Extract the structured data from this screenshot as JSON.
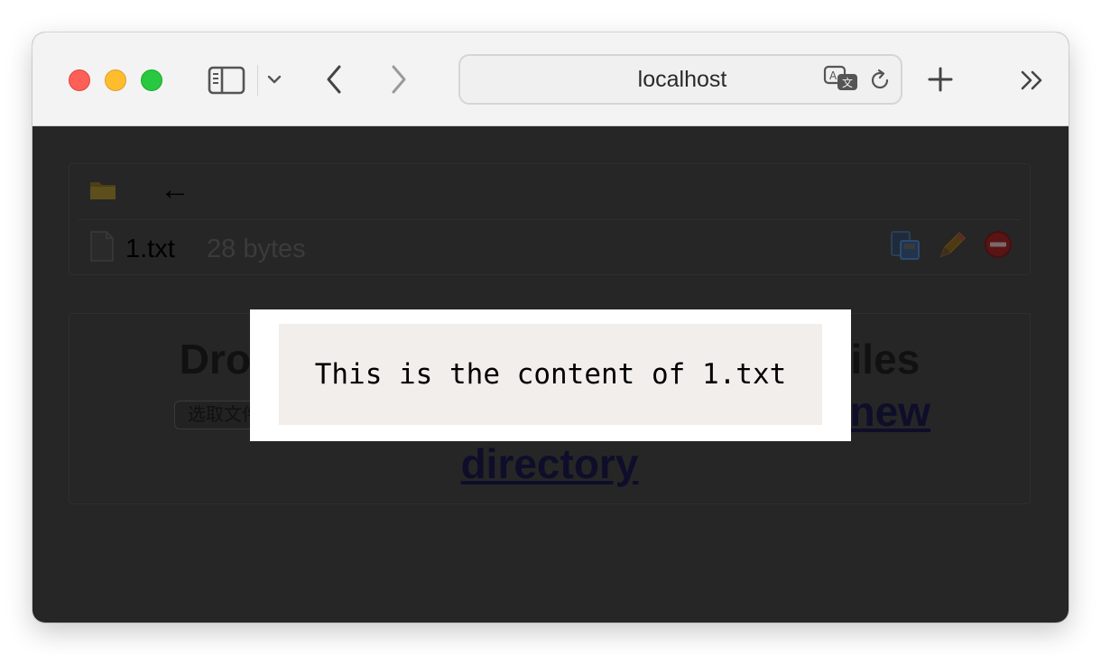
{
  "browser": {
    "address": "localhost",
    "icons": [
      "sidebar-icon",
      "chevron-down-icon",
      "back-icon",
      "forward-icon",
      "translate-icon",
      "reload-icon",
      "plus-icon",
      "more-icon"
    ]
  },
  "file_list": {
    "up_arrow": "←",
    "files": [
      {
        "name": "1.txt",
        "size": "28 bytes"
      }
    ]
  },
  "upload": {
    "drop_text": "Drop files here or click to upload files",
    "choose_button": "选取文件",
    "new_directory_line1": "new",
    "new_directory_line2": "directory"
  },
  "modal": {
    "content": "This is the content of 1.txt"
  },
  "colors": {
    "toolbar_bg": "#f4f3f3",
    "overlay_bg": "#262626",
    "modal_pre_bg": "#f1eeeb"
  }
}
